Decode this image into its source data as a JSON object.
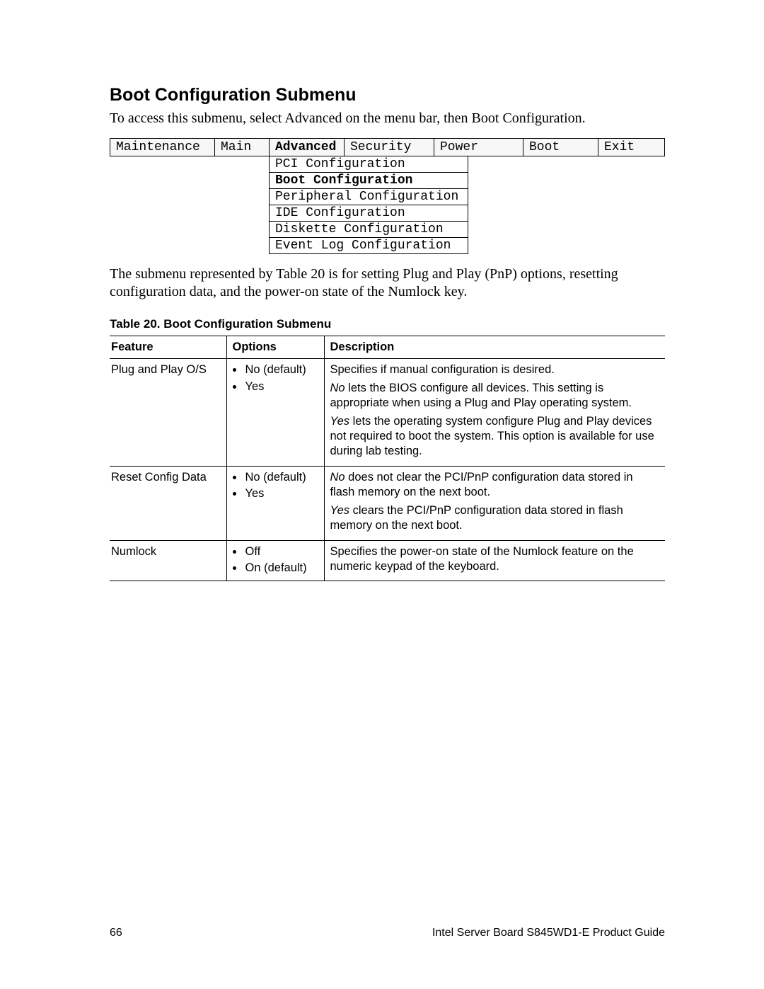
{
  "heading": "Boot Configuration Submenu",
  "intro": "To access this submenu, select Advanced on the menu bar, then Boot Configuration.",
  "menubar": {
    "items": [
      "Maintenance",
      "Main",
      "Advanced",
      "Security",
      "Power",
      "Boot",
      "Exit"
    ],
    "active_index": 2
  },
  "submenu": {
    "items": [
      "PCI Configuration",
      "Boot Configuration",
      "Peripheral Configuration",
      "IDE Configuration",
      "Diskette Configuration",
      "Event Log Configuration"
    ],
    "selected_index": 1
  },
  "paragraph2": "The submenu represented by Table 20 is for setting Plug and Play (PnP) options, resetting configuration data, and the power-on state of the Numlock key.",
  "table_caption": "Table 20.    Boot Configuration Submenu",
  "table": {
    "headers": [
      "Feature",
      "Options",
      "Description"
    ],
    "rows": [
      {
        "feature": "Plug and Play O/S",
        "options": [
          "No (default)",
          "Yes"
        ],
        "description_parts": [
          {
            "text": "Specifies if manual configuration is desired."
          },
          {
            "lead_italic": "No",
            "rest": " lets the BIOS configure all devices.  This setting is appropriate when using a Plug and Play operating system."
          },
          {
            "lead_italic": "Yes",
            "rest": " lets the operating system configure Plug and Play devices not required to boot the system.  This option is available for use during lab testing."
          }
        ]
      },
      {
        "feature": "Reset Config Data",
        "options": [
          "No (default)",
          "Yes"
        ],
        "description_parts": [
          {
            "lead_italic": "No",
            "rest": " does not clear the PCI/PnP configuration data stored in flash memory on the next boot."
          },
          {
            "lead_italic": "Yes",
            "rest": " clears the PCI/PnP configuration data stored in flash memory on the next boot."
          }
        ]
      },
      {
        "feature": "Numlock",
        "options": [
          "Off",
          "On (default)"
        ],
        "description_parts": [
          {
            "text": "Specifies the power-on state of the Numlock feature on the numeric keypad of the keyboard."
          }
        ]
      }
    ]
  },
  "footer": {
    "page_number": "66",
    "doc_title": "Intel Server Board S845WD1-E Product Guide"
  }
}
